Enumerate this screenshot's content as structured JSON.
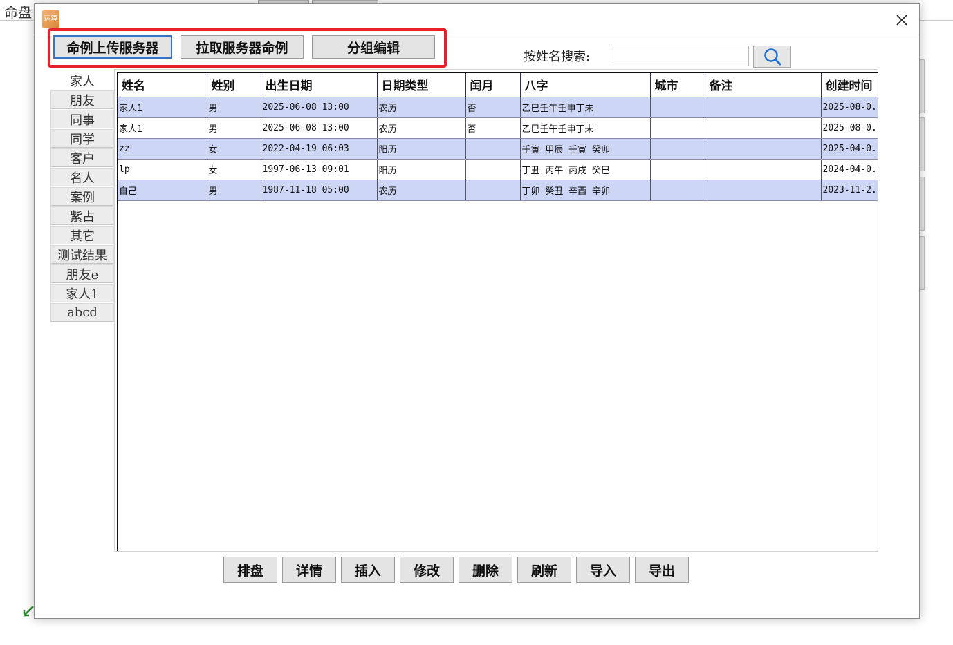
{
  "background": {
    "title": "命盘"
  },
  "dialog": {
    "icon_text": "运算",
    "top_buttons": {
      "upload": "命例上传服务器",
      "pull": "拉取服务器命例",
      "group_edit": "分组编辑"
    },
    "search": {
      "label": "按姓名搜索:",
      "value": ""
    },
    "groups": [
      "家人",
      "朋友",
      "同事",
      "同学",
      "客户",
      "名人",
      "案例",
      "紫占",
      "其它",
      "测试结果",
      "朋友e",
      "家人1",
      "abcd"
    ],
    "selected_group": "家人",
    "table": {
      "headers": [
        "姓名",
        "姓别",
        "出生日期",
        "日期类型",
        "闰月",
        "八字",
        "城市",
        "备注",
        "创建时间"
      ],
      "rows": [
        [
          "家人1",
          "男",
          "2025-06-08 13:00",
          "农历",
          "否",
          "乙巳壬午壬申丁未",
          "",
          "",
          "2025-08-0."
        ],
        [
          "家人1",
          "男",
          "2025-06-08 13:00",
          "农历",
          "否",
          "乙巳壬午壬申丁未",
          "",
          "",
          "2025-08-0."
        ],
        [
          "zz",
          "女",
          "2022-04-19 06:03",
          "阳历",
          "",
          "壬寅 甲辰 壬寅 癸卯",
          "",
          "",
          "2025-04-0."
        ],
        [
          "lp",
          "女",
          "1997-06-13 09:01",
          "阳历",
          "",
          "丁丑 丙午 丙戌 癸巳",
          "",
          "",
          "2024-04-0."
        ],
        [
          "自己",
          "男",
          "1987-11-18 05:00",
          "农历",
          "",
          "丁卯 癸丑 辛酉 辛卯",
          "",
          "",
          "2023-11-2."
        ]
      ]
    },
    "bottom_buttons": [
      "排盘",
      "详情",
      "插入",
      "修改",
      "删除",
      "刷新",
      "导入",
      "导出"
    ]
  },
  "colors": {
    "highlight": "#e8202a",
    "row_alt": "#cdd6f4",
    "active_border": "#3b73c7"
  }
}
